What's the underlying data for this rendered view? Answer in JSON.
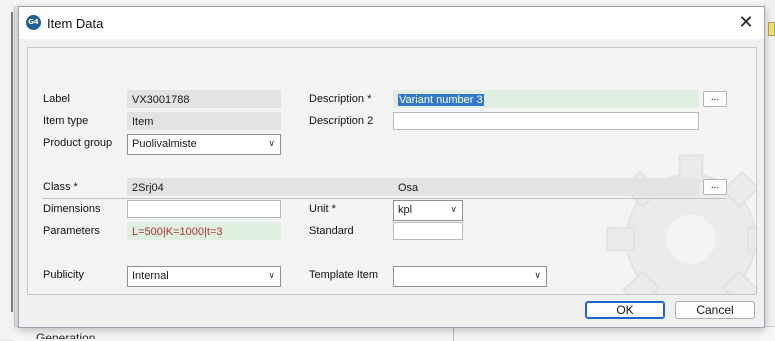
{
  "background": {
    "partial_text": "Generation"
  },
  "dialog": {
    "title": "Item Data",
    "icon_label": "G4",
    "close_glyph": "✕"
  },
  "fields": {
    "label": {
      "caption": "Label",
      "value": "VX3001788"
    },
    "item_type": {
      "caption": "Item type",
      "value": "Item"
    },
    "product_group": {
      "caption": "Product group",
      "value": "Puolivalmiste"
    },
    "description": {
      "caption": "Description *",
      "value": "Variant number 3"
    },
    "description2": {
      "caption": "Description 2",
      "value": ""
    },
    "class": {
      "caption": "Class *",
      "value": "2Srj04",
      "extra": "Osa"
    },
    "dimensions": {
      "caption": "Dimensions",
      "value": ""
    },
    "parameters": {
      "caption": "Parameters",
      "value": "L=500|K=1000|t=3"
    },
    "unit": {
      "caption": "Unit *",
      "value": "kpl"
    },
    "standard": {
      "caption": "Standard",
      "value": ""
    },
    "publicity": {
      "caption": "Publicity",
      "value": "Internal"
    },
    "template_item": {
      "caption": "Template Item",
      "value": ""
    }
  },
  "ellipsis_label": "...",
  "buttons": {
    "ok": "OK",
    "cancel": "Cancel"
  },
  "colors": {
    "accent": "#1b68c8",
    "selection": "#3478c8",
    "required_highlight": "#dff0e3",
    "parameter_text": "#b0322a"
  }
}
